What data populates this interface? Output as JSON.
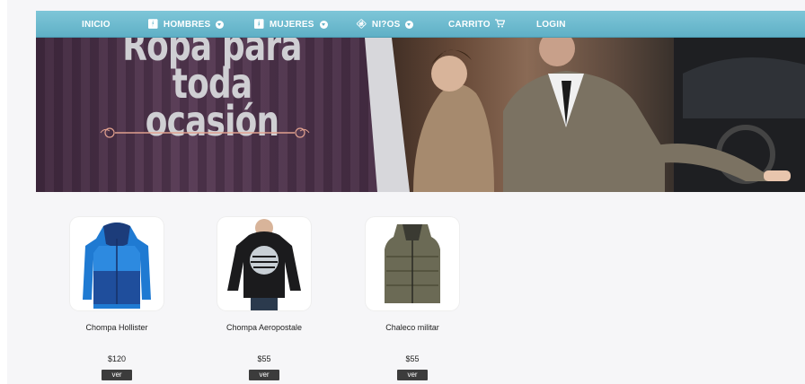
{
  "nav": {
    "items": [
      {
        "label": "INICIO",
        "icon": "",
        "dropdown": false
      },
      {
        "label": "HOMBRES",
        "icon": "man-icon",
        "dropdown": true
      },
      {
        "label": "MUJERES",
        "icon": "woman-icon",
        "dropdown": true
      },
      {
        "label": "NI?OS",
        "icon": "child-icon",
        "dropdown": true
      },
      {
        "label": "CARRITO",
        "icon": "cart-icon",
        "dropdown": false
      },
      {
        "label": "LOGIN",
        "icon": "",
        "dropdown": false
      }
    ],
    "color": "#6ab8cc"
  },
  "banner": {
    "line1": "Ropa para",
    "line2": "toda ocasión"
  },
  "products": [
    {
      "name": "Chompa Hollister",
      "price": "$120",
      "button": "ver"
    },
    {
      "name": "Chompa Aeropostale",
      "price": "$55",
      "button": "ver"
    },
    {
      "name": "Chaleco militar",
      "price": "$55",
      "button": "ver"
    }
  ]
}
